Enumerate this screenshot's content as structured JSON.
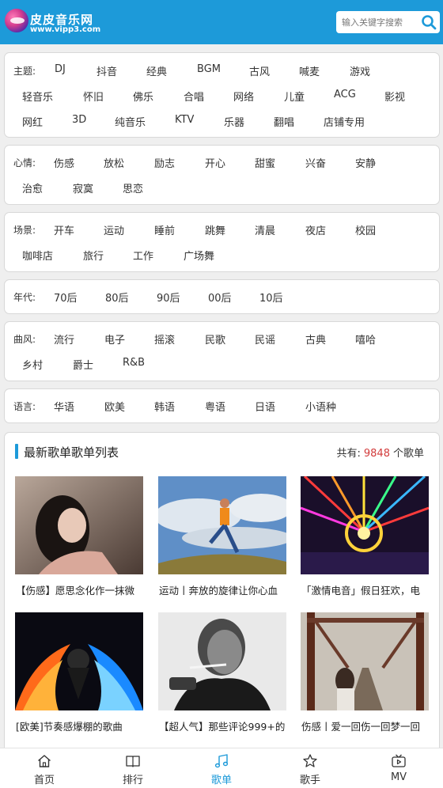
{
  "colors": {
    "brand": "#1d9ad9",
    "count": "#d23b3b",
    "active_nav": "#1d9ad9"
  },
  "header": {
    "site_name": "皮皮音乐网",
    "site_url": "www.vipp3.com",
    "search_placeholder": "输入关键字搜索",
    "search_icon": "search-icon"
  },
  "filters": {
    "theme": {
      "label": "主题:",
      "tags": [
        "DJ",
        "抖音",
        "经典",
        "BGM",
        "古风",
        "喊麦",
        "游戏",
        "轻音乐",
        "怀旧",
        "佛乐",
        "合唱",
        "网络",
        "儿童",
        "ACG",
        "影视",
        "网红",
        "3D",
        "纯音乐",
        "KTV",
        "乐器",
        "翻唱",
        "店铺专用"
      ]
    },
    "mood": {
      "label": "心情:",
      "tags": [
        "伤感",
        "放松",
        "励志",
        "开心",
        "甜蜜",
        "兴奋",
        "安静",
        "治愈",
        "寂寞",
        "思恋"
      ]
    },
    "scene": {
      "label": "场景:",
      "tags": [
        "开车",
        "运动",
        "睡前",
        "跳舞",
        "清晨",
        "夜店",
        "校园",
        "咖啡店",
        "旅行",
        "工作",
        "广场舞"
      ]
    },
    "era": {
      "label": "年代:",
      "tags": [
        "70后",
        "80后",
        "90后",
        "00后",
        "10后"
      ]
    },
    "genre": {
      "label": "曲风:",
      "tags": [
        "流行",
        "电子",
        "摇滚",
        "民歌",
        "民谣",
        "古典",
        "嘻哈",
        "乡村",
        "爵士",
        "R&B"
      ]
    },
    "language": {
      "label": "语言:",
      "tags": [
        "华语",
        "欧美",
        "韩语",
        "粤语",
        "日语",
        "小语种"
      ]
    }
  },
  "list": {
    "title": "最新歌单歌单列表",
    "total_prefix": "共有:",
    "total_count": "9848",
    "total_suffix": "个歌单",
    "items": [
      {
        "title": "【伤感】愿思念化作一抹微"
      },
      {
        "title": "运动丨奔放的旋律让你心血"
      },
      {
        "title": "「激情电音」假日狂欢，电"
      },
      {
        "title": "[欧美]节奏感爆棚的歌曲"
      },
      {
        "title": "【超人气】那些评论999+的"
      },
      {
        "title": "伤感丨爱一回伤一回梦一回"
      }
    ]
  },
  "nav": {
    "items": [
      {
        "label": "首页",
        "icon": "home-icon"
      },
      {
        "label": "排行",
        "icon": "book-icon"
      },
      {
        "label": "歌单",
        "icon": "music-note-icon",
        "active": true
      },
      {
        "label": "歌手",
        "icon": "star-icon"
      },
      {
        "label": "MV",
        "icon": "tv-icon"
      }
    ]
  }
}
